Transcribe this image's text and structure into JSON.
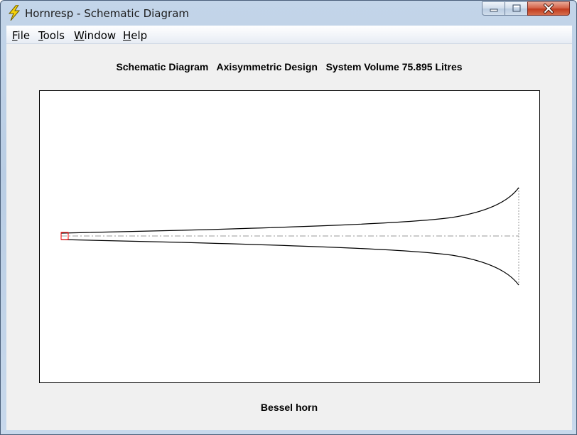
{
  "window": {
    "title": "Hornresp - Schematic Diagram",
    "app_icon": "lightning-bolt-icon",
    "controls": [
      "minimize-icon",
      "maximize-icon",
      "close-icon"
    ]
  },
  "menu": {
    "items": [
      {
        "label": "File",
        "mnemonic": "F",
        "rest": "ile"
      },
      {
        "label": "Tools",
        "mnemonic": "T",
        "rest": "ools"
      },
      {
        "label": "Window",
        "mnemonic": "W",
        "rest": "indow"
      },
      {
        "label": "Help",
        "mnemonic": "H",
        "rest": "elp"
      }
    ]
  },
  "diagram": {
    "header": "Schematic Diagram   Axisymmetric Design   System Volume 75.895 Litres",
    "footer": "Bessel horn",
    "colors": {
      "outline": "#000000",
      "axis": "#999999",
      "throat_marker": "#ff0000"
    }
  }
}
